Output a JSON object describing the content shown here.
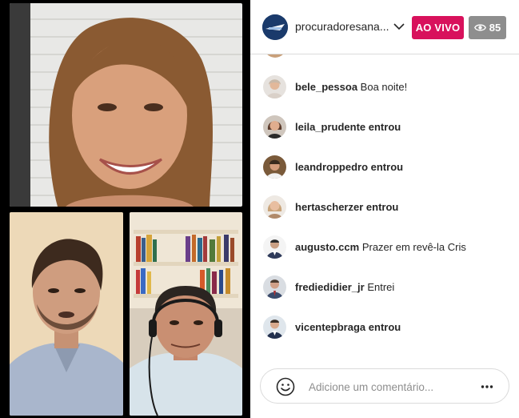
{
  "header": {
    "channel_name": "procuradoresana...",
    "live_label": "AO VIVO",
    "viewer_count": "85"
  },
  "comments": [
    {
      "user": "bele_pessoa",
      "message": "Boa noite!",
      "joined": ""
    },
    {
      "user": "leila_prudente",
      "message": "",
      "joined": "entrou"
    },
    {
      "user": "leandroppedro",
      "message": "",
      "joined": "entrou"
    },
    {
      "user": "hertascherzer",
      "message": "",
      "joined": "entrou"
    },
    {
      "user": "augusto.ccm",
      "message": "Prazer em revê-la Cris",
      "joined": ""
    },
    {
      "user": "frediedidier_jr",
      "message": "Entrei",
      "joined": ""
    },
    {
      "user": "vicentepbraga",
      "message": "",
      "joined": "entrou"
    }
  ],
  "comment_bar": {
    "placeholder": "Adicione um comentário..."
  },
  "colors": {
    "live_badge": "#d8115c",
    "viewer_badge": "#8e8e8e",
    "text": "#262626",
    "muted": "#8e8e8e"
  },
  "icons": {
    "channel": "channel-logo-avatar",
    "chevron": "chevron-down-icon",
    "viewers": "eye-icon",
    "emoji": "emoji-icon",
    "more": "more-options-icon"
  }
}
